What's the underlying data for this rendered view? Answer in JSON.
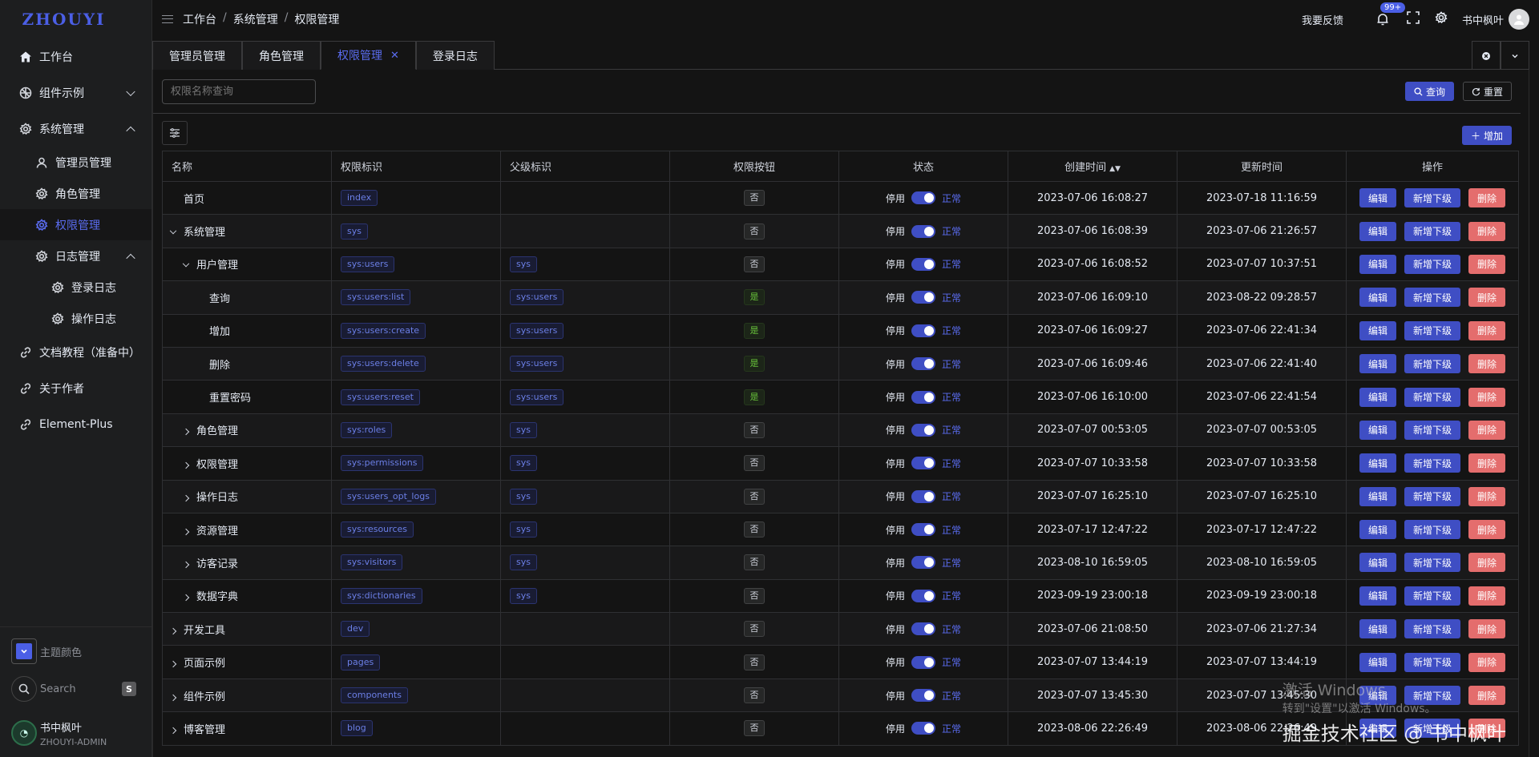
{
  "app": {
    "logo": "ZHOUYI"
  },
  "sidebar": {
    "items": [
      {
        "label": "工作台",
        "icon": "home-icon",
        "level": 0
      },
      {
        "label": "组件示例",
        "icon": "grid-icon",
        "level": 0,
        "expandable": true,
        "expanded": false
      },
      {
        "label": "系统管理",
        "icon": "gear-icon",
        "level": 0,
        "expandable": true,
        "expanded": true
      },
      {
        "label": "管理员管理",
        "icon": "user-icon",
        "level": 1
      },
      {
        "label": "角色管理",
        "icon": "gear-icon",
        "level": 1
      },
      {
        "label": "权限管理",
        "icon": "gear-icon",
        "level": 1,
        "active": true
      },
      {
        "label": "日志管理",
        "icon": "gear-icon",
        "level": 1,
        "expandable": true,
        "expanded": true
      },
      {
        "label": "登录日志",
        "icon": "gear-icon",
        "level": 2
      },
      {
        "label": "操作日志",
        "icon": "gear-icon",
        "level": 2
      },
      {
        "label": "文档教程（准备中）",
        "icon": "link-icon",
        "level": 0
      },
      {
        "label": "关于作者",
        "icon": "link-icon",
        "level": 0
      },
      {
        "label": "Element-Plus",
        "icon": "link-icon",
        "level": 0
      }
    ],
    "theme_label": "主题颜色",
    "search_label": "Search",
    "search_shortcut": "S",
    "user_name": "书中枫叶",
    "user_role": "ZHOUYI-ADMIN"
  },
  "header": {
    "breadcrumb": [
      "工作台",
      "系统管理",
      "权限管理"
    ],
    "feedback": "我要反馈",
    "badge": "99+",
    "user": "书中枫叶"
  },
  "tabs": [
    {
      "label": "管理员管理"
    },
    {
      "label": "角色管理"
    },
    {
      "label": "权限管理",
      "active": true
    },
    {
      "label": "登录日志"
    }
  ],
  "search": {
    "placeholder": "权限名称查询",
    "query_label": "查询",
    "reset_label": "重置"
  },
  "toolbar": {
    "add_label": "增加"
  },
  "table": {
    "columns": [
      "名称",
      "权限标识",
      "父级标识",
      "权限按钮",
      "状态",
      "创建时间",
      "更新时间",
      "操作"
    ],
    "status_off": "停用",
    "status_on": "正常",
    "actions": {
      "edit": "编辑",
      "add_child": "新增下级",
      "delete": "删除"
    },
    "rows": [
      {
        "name": "首页",
        "depth": 0,
        "expander": "",
        "key": "index",
        "parent": "",
        "button": "否",
        "created": "2023-07-06 16:08:27",
        "updated": "2023-07-18 11:16:59"
      },
      {
        "name": "系统管理",
        "depth": 0,
        "expander": "down",
        "key": "sys",
        "parent": "",
        "button": "否",
        "created": "2023-07-06 16:08:39",
        "updated": "2023-07-06 21:26:57"
      },
      {
        "name": "用户管理",
        "depth": 1,
        "expander": "down",
        "key": "sys:users",
        "parent": "sys",
        "button": "否",
        "created": "2023-07-06 16:08:52",
        "updated": "2023-07-07 10:37:51"
      },
      {
        "name": "查询",
        "depth": 2,
        "expander": "",
        "key": "sys:users:list",
        "parent": "sys:users",
        "button": "是",
        "created": "2023-07-06 16:09:10",
        "updated": "2023-08-22 09:28:57"
      },
      {
        "name": "增加",
        "depth": 2,
        "expander": "",
        "key": "sys:users:create",
        "parent": "sys:users",
        "button": "是",
        "created": "2023-07-06 16:09:27",
        "updated": "2023-07-06 22:41:34"
      },
      {
        "name": "删除",
        "depth": 2,
        "expander": "",
        "key": "sys:users:delete",
        "parent": "sys:users",
        "button": "是",
        "created": "2023-07-06 16:09:46",
        "updated": "2023-07-06 22:41:40"
      },
      {
        "name": "重置密码",
        "depth": 2,
        "expander": "",
        "key": "sys:users:reset",
        "parent": "sys:users",
        "button": "是",
        "created": "2023-07-06 16:10:00",
        "updated": "2023-07-06 22:41:54"
      },
      {
        "name": "角色管理",
        "depth": 1,
        "expander": "right",
        "key": "sys:roles",
        "parent": "sys",
        "button": "否",
        "created": "2023-07-07 00:53:05",
        "updated": "2023-07-07 00:53:05"
      },
      {
        "name": "权限管理",
        "depth": 1,
        "expander": "right",
        "key": "sys:permissions",
        "parent": "sys",
        "button": "否",
        "created": "2023-07-07 10:33:58",
        "updated": "2023-07-07 10:33:58"
      },
      {
        "name": "操作日志",
        "depth": 1,
        "expander": "right",
        "key": "sys:users_opt_logs",
        "parent": "sys",
        "button": "否",
        "created": "2023-07-07 16:25:10",
        "updated": "2023-07-07 16:25:10"
      },
      {
        "name": "资源管理",
        "depth": 1,
        "expander": "right",
        "key": "sys:resources",
        "parent": "sys",
        "button": "否",
        "created": "2023-07-17 12:47:22",
        "updated": "2023-07-17 12:47:22"
      },
      {
        "name": "访客记录",
        "depth": 1,
        "expander": "right",
        "key": "sys:visitors",
        "parent": "sys",
        "button": "否",
        "created": "2023-08-10 16:59:05",
        "updated": "2023-08-10 16:59:05"
      },
      {
        "name": "数据字典",
        "depth": 1,
        "expander": "right",
        "key": "sys:dictionaries",
        "parent": "sys",
        "button": "否",
        "created": "2023-09-19 23:00:18",
        "updated": "2023-09-19 23:00:18"
      },
      {
        "name": "开发工具",
        "depth": 0,
        "expander": "right",
        "key": "dev",
        "parent": "",
        "button": "否",
        "created": "2023-07-06 21:08:50",
        "updated": "2023-07-06 21:27:34"
      },
      {
        "name": "页面示例",
        "depth": 0,
        "expander": "right",
        "key": "pages",
        "parent": "",
        "button": "否",
        "created": "2023-07-07 13:44:19",
        "updated": "2023-07-07 13:44:19"
      },
      {
        "name": "组件示例",
        "depth": 0,
        "expander": "right",
        "key": "components",
        "parent": "",
        "button": "否",
        "created": "2023-07-07 13:45:30",
        "updated": "2023-07-07 13:45:30"
      },
      {
        "name": "博客管理",
        "depth": 0,
        "expander": "right",
        "key": "blog",
        "parent": "",
        "button": "否",
        "created": "2023-08-06 22:26:49",
        "updated": "2023-08-06 22:26:49"
      }
    ]
  },
  "watermark": {
    "activate_title": "激活 Windows",
    "activate_hint": "转到\"设置\"以激活 Windows。",
    "site": "掘金技术社区 @ 书中枫叶"
  },
  "colors": {
    "accent": "#4b5fe6",
    "danger": "#e46d6d",
    "success": "#67c23a",
    "background": "#141414"
  }
}
